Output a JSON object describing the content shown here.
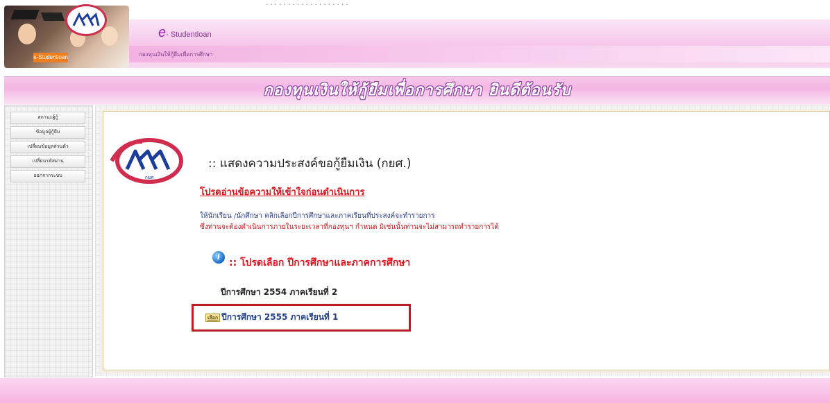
{
  "header": {
    "app_prefix": "e",
    "app_name": "- Studentloan",
    "subtitle": "กองทุนเงินให้กู้ยืมเพื่อการศึกษา",
    "top_dots": "...................",
    "photo_tag": "e-Studentloan"
  },
  "banner": {
    "text": "กองทุนเงินให้กู้ยืมเพื่อการศึกษา ยินดีต้อนรับ"
  },
  "sidebar": {
    "items": [
      {
        "label": "สถานะผู้กู้"
      },
      {
        "label": "ข้อมูลผู้กู้ยืม"
      },
      {
        "label": "เปลี่ยนข้อมูลส่วนตัว"
      },
      {
        "label": "เปลี่ยนรหัสผ่าน"
      },
      {
        "label": "ออกจากระบบ"
      }
    ]
  },
  "content": {
    "logo_text": "กยศ",
    "heading": ":: แสดงความประสงค์ขอกู้ยืมเงิน (กยศ.)",
    "notice": "โปรดอ่านข้อความให้เข้าใจก่อนดำเนินการ",
    "instruction_1": "ให้นักเรียน /นักศึกษา คลิกเลือกปีการศึกษาและภาคเรียนที่ประสงค์จะทำรายการ",
    "instruction_2": "ซึ่งท่านจะต้องดำเนินการภายในระยะเวลาที่กองทุนฯ กำหนด มิเช่นนั้นท่านจะไม่สามารถทำรายการได้",
    "select_title": ":: โปรดเลือก ปีการศึกษาและภาคการศึกษา",
    "years": [
      {
        "label": "ปีการศึกษา  2554  ภาคเรียนที่  2"
      },
      {
        "link": "เลือก",
        "label": "ปีการศึกษา  2555  ภาคเรียนที่  1"
      }
    ]
  },
  "colors": {
    "accent_pink": "#f4b6e4",
    "notice_red": "#e0111a",
    "highlight_border": "#b81e24",
    "link_blue": "#1f3f8a"
  }
}
